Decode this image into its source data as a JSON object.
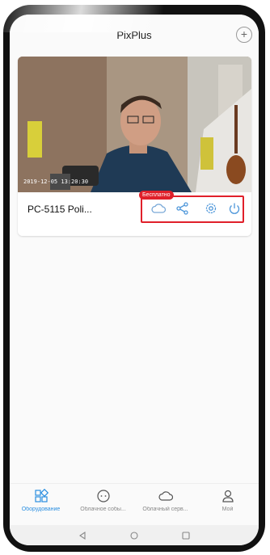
{
  "header": {
    "title": "PixPlus",
    "add_symbol": "+"
  },
  "camera": {
    "name": "PC-5115 Poli...",
    "timestamp": "2019-12-05 13:20:30",
    "cloud_badge": "Бесплатно"
  },
  "nav": {
    "items": [
      {
        "label": "Оборудование",
        "icon": "devices-icon"
      },
      {
        "label": "Облачное собы...",
        "icon": "cloud-events-icon"
      },
      {
        "label": "Облачный серв...",
        "icon": "cloud-service-icon"
      },
      {
        "label": "Мой",
        "icon": "profile-icon"
      }
    ]
  },
  "colors": {
    "accent": "#2a8ee0",
    "highlight": "#e0202a"
  }
}
